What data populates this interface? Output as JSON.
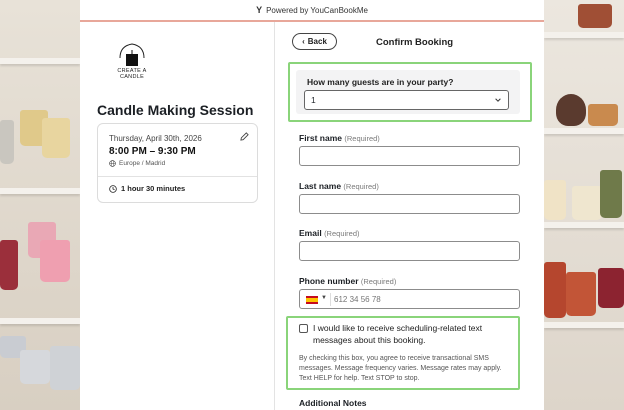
{
  "powered": {
    "label": "Powered by YouCanBookMe"
  },
  "business": {
    "logo_text": "CREATE A CANDLE"
  },
  "session": {
    "title": "Candle Making Session",
    "date": "Thursday, April 30th, 2026",
    "time": "8:00 PM – 9:30 PM",
    "timezone": "Europe / Madrid",
    "duration": "1 hour 30 minutes"
  },
  "header": {
    "back_label": "Back",
    "title": "Confirm Booking"
  },
  "form": {
    "guests": {
      "label": "How many guests are in your party?",
      "value": "1"
    },
    "first_name": {
      "label": "First name",
      "required": "(Required)",
      "value": ""
    },
    "last_name": {
      "label": "Last name",
      "required": "(Required)",
      "value": ""
    },
    "email": {
      "label": "Email",
      "required": "(Required)",
      "value": ""
    },
    "phone": {
      "label": "Phone number",
      "required": "(Required)",
      "placeholder": "612 34 56 78",
      "country": "ES"
    },
    "sms": {
      "checkbox_label": "I would like to receive scheduling-related text messages about this booking.",
      "fine_print": "By checking this box, you agree to receive transactional SMS messages. Message frequency varies. Message rates may apply. Text HELP for help. Text STOP to stop.",
      "checked": false
    },
    "additional_notes": {
      "label": "Additional Notes"
    }
  },
  "colors": {
    "highlight": "#8ad47a",
    "accent_line": "#e8a79a"
  }
}
